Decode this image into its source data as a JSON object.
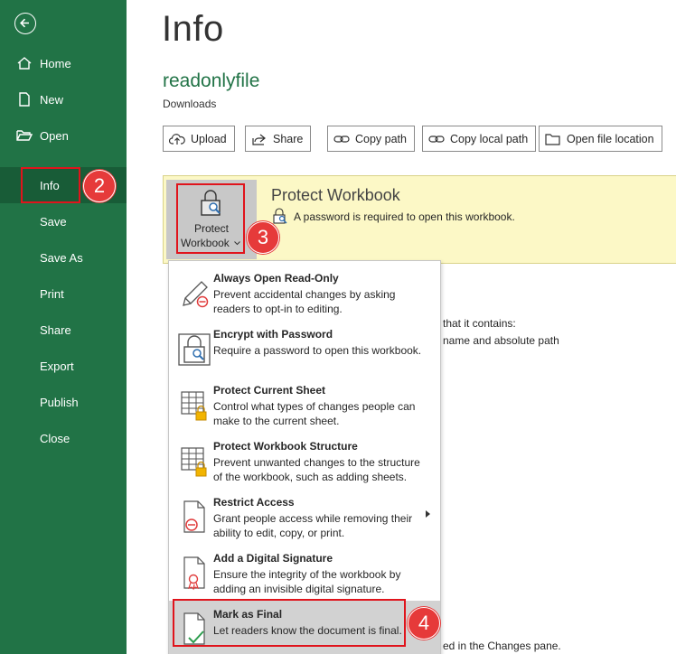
{
  "sidebar": {
    "back_icon": "back-arrow-icon",
    "items": [
      {
        "label": "Home",
        "icon": "home-icon"
      },
      {
        "label": "New",
        "icon": "new-document-icon"
      },
      {
        "label": "Open",
        "icon": "folder-open-icon"
      },
      {
        "label": "Info"
      },
      {
        "label": "Save"
      },
      {
        "label": "Save As"
      },
      {
        "label": "Print"
      },
      {
        "label": "Share"
      },
      {
        "label": "Export"
      },
      {
        "label": "Publish"
      },
      {
        "label": "Close"
      }
    ],
    "active": "Info"
  },
  "badges": {
    "step2": "2",
    "step3": "3",
    "step4": "4"
  },
  "main": {
    "title": "Info",
    "file_name": "readonlyfile",
    "file_location": "Downloads",
    "actions": [
      {
        "label": "Upload",
        "icon": "upload-icon"
      },
      {
        "label": "Share",
        "icon": "share-icon"
      },
      {
        "label": "Copy path",
        "icon": "link-icon"
      },
      {
        "label": "Copy local path",
        "icon": "link-icon"
      },
      {
        "label": "Open file location",
        "icon": "folder-icon"
      }
    ],
    "protect": {
      "button_line1": "Protect",
      "button_line2": "Workbook",
      "title": "Protect Workbook",
      "description": "A password is required to open this workbook."
    },
    "background_fragments": [
      "that it contains:",
      "name and absolute path",
      "ed in the Changes pane."
    ]
  },
  "menu": {
    "items": [
      {
        "title": "Always Open Read-Only",
        "desc": "Prevent accidental changes by asking readers to opt-in to editing.",
        "icon": "pencil-no-icon"
      },
      {
        "title": "Encrypt with Password",
        "desc": "Require a password to open this workbook.",
        "icon": "lock-key-icon"
      },
      {
        "title": "Protect Current Sheet",
        "desc": "Control what types of changes people can make to the current sheet.",
        "icon": "sheet-lock-icon"
      },
      {
        "title": "Protect Workbook Structure",
        "desc": "Prevent unwanted changes to the structure of the workbook, such as adding sheets.",
        "icon": "workbook-lock-icon"
      },
      {
        "title": "Restrict Access",
        "desc": "Grant people access while removing their ability to edit, copy, or print.",
        "icon": "document-restrict-icon"
      },
      {
        "title": "Add a Digital Signature",
        "desc": "Ensure the integrity of the workbook by adding an invisible digital signature.",
        "icon": "document-ribbon-icon"
      },
      {
        "title": "Mark as Final",
        "desc": "Let readers know the document is final.",
        "icon": "document-check-icon"
      }
    ]
  },
  "colors": {
    "sidebar": "#217346",
    "sidebar_active": "#185c37",
    "panel": "#fcf8c6",
    "highlight": "#e0141c",
    "badge": "#e63a3a"
  }
}
